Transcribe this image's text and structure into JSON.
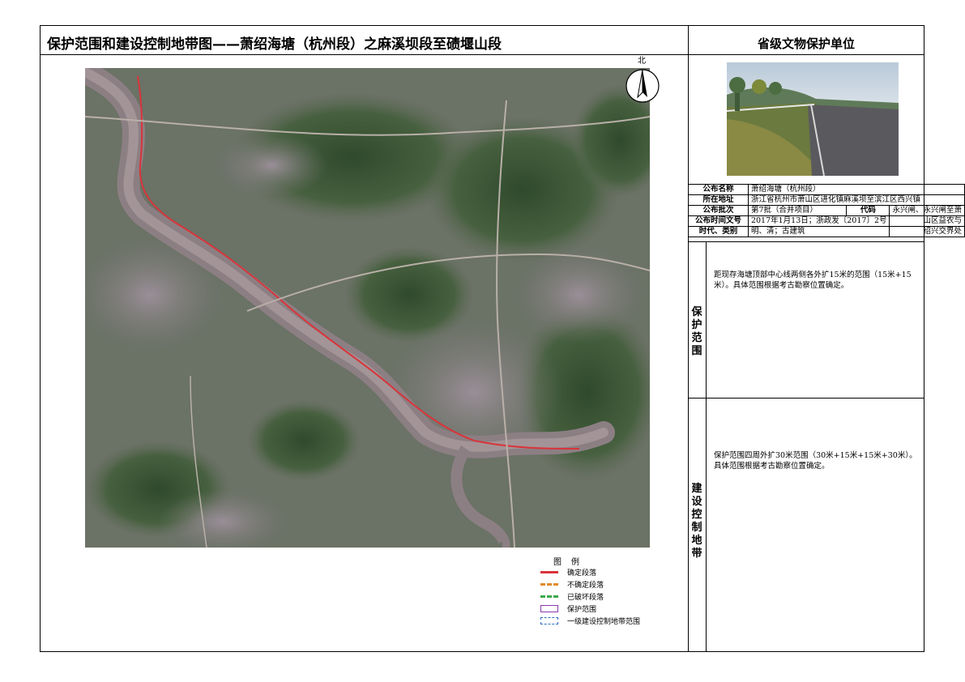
{
  "header": {
    "title": "保护范围和建设控制地带图——萧绍海塘（杭州段）之麻溪坝段至碛堰山段",
    "unit_level": "省级文物保护单位"
  },
  "compass": {
    "label": "北"
  },
  "info": {
    "rows": [
      {
        "label": "公布名称",
        "value": "萧绍海塘（杭州段）"
      },
      {
        "label": "所在地址",
        "value": "浙江省杭州市萧山区进化镇麻溪坝至滨江区西兴镇"
      },
      {
        "label": "公布批次",
        "value": "第7批（合并项目）",
        "sub_label": "代码",
        "sub_value": "永兴闸、永兴闸至萧"
      },
      {
        "label": "公布时间文号",
        "value": "2017年1月13日；浙政发〔2017〕2号",
        "extra": "山区益农与"
      },
      {
        "label": "时代、类别",
        "value": "明、清；古建筑",
        "extra": "绍兴交界处"
      }
    ]
  },
  "protection": {
    "label": "保护范围",
    "text": "距现存海塘顶部中心线两侧各外扩15米的范围（15米+15米）。具体范围根据考古勘察位置确定。"
  },
  "control": {
    "label": "建设控制地带",
    "text": "保护范围四周外扩30米范围（30米+15米+15米+30米）。具体范围根据考古勘察位置确定。"
  },
  "legend": {
    "title": "图例",
    "items": [
      {
        "label": "确定段落",
        "color": "#d9343a",
        "style": "solid"
      },
      {
        "label": "不确定段落",
        "color": "#e08a2a",
        "style": "dashed"
      },
      {
        "label": "已破坏段落",
        "color": "#3aa84a",
        "style": "dashed"
      },
      {
        "label": "保护范围",
        "color": "#8a3ab0",
        "style": "box"
      },
      {
        "label": "一级建设控制地带范围",
        "color": "#2f6fc0",
        "style": "dashed-box"
      }
    ]
  }
}
